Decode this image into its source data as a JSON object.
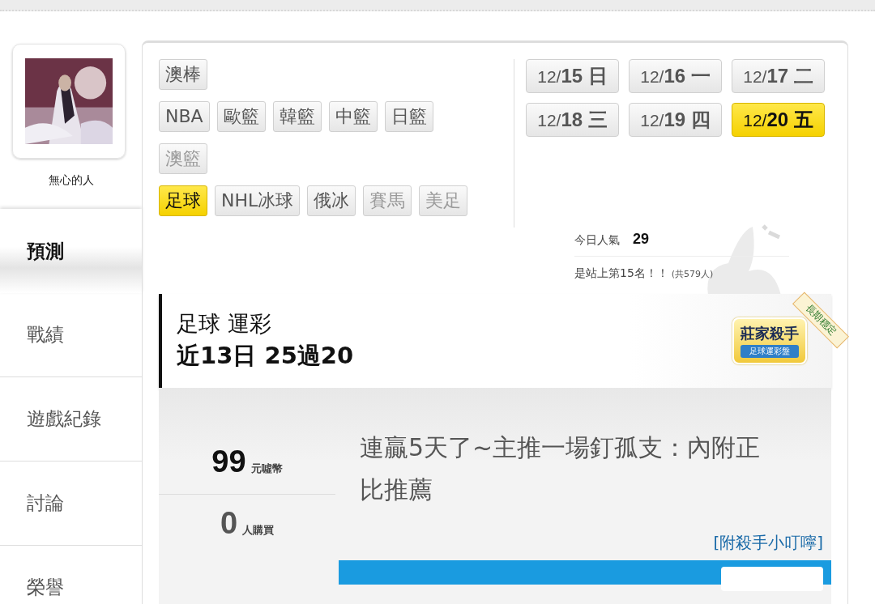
{
  "profile": {
    "name": "無心的人"
  },
  "nav": [
    {
      "label": "預測",
      "selected": true
    },
    {
      "label": "戰績",
      "selected": false
    },
    {
      "label": "遊戲紀錄",
      "selected": false
    },
    {
      "label": "討論",
      "selected": false
    },
    {
      "label": "榮譽",
      "selected": false
    }
  ],
  "sport_rows": [
    [
      {
        "label": "澳棒",
        "selected": false,
        "disabled": false
      }
    ],
    [
      {
        "label": "NBA",
        "selected": false,
        "disabled": false
      },
      {
        "label": "歐籃",
        "selected": false,
        "disabled": false
      },
      {
        "label": "韓籃",
        "selected": false,
        "disabled": false
      },
      {
        "label": "中籃",
        "selected": false,
        "disabled": false
      },
      {
        "label": "日籃",
        "selected": false,
        "disabled": false
      }
    ],
    [
      {
        "label": "澳籃",
        "selected": false,
        "disabled": true
      }
    ],
    [
      {
        "label": "足球",
        "selected": true,
        "disabled": false
      },
      {
        "label": "NHL冰球",
        "selected": false,
        "disabled": false
      },
      {
        "label": "俄冰",
        "selected": false,
        "disabled": false
      },
      {
        "label": "賽馬",
        "selected": false,
        "disabled": true
      },
      {
        "label": "美足",
        "selected": false,
        "disabled": true
      }
    ]
  ],
  "dates": [
    {
      "month": "12/",
      "day": "15",
      "weekday": "日",
      "selected": false
    },
    {
      "month": "12/",
      "day": "16",
      "weekday": "一",
      "selected": false
    },
    {
      "month": "12/",
      "day": "17",
      "weekday": "二",
      "selected": false
    },
    {
      "month": "12/",
      "day": "18",
      "weekday": "三",
      "selected": false
    },
    {
      "month": "12/",
      "day": "19",
      "weekday": "四",
      "selected": false
    },
    {
      "month": "12/",
      "day": "20",
      "weekday": "五",
      "selected": true
    }
  ],
  "popularity": {
    "label": "今日人氣",
    "value": "29",
    "rank": "是站上第15名！！",
    "total": "(共579人)"
  },
  "record": {
    "title": "足球 運彩",
    "summary": "近13日 25過20",
    "badge": {
      "title": "莊家殺手",
      "subtitle": "足球運彩盤",
      "ribbon": "長期穩定"
    }
  },
  "offer": {
    "price": "99",
    "price_unit": "元噓幣",
    "buyers": "0",
    "buyers_unit": "人購買",
    "headline": "連贏5天了~主推一場釘孤支：內附正比推薦",
    "link": "[附殺手小叮嚀]"
  }
}
